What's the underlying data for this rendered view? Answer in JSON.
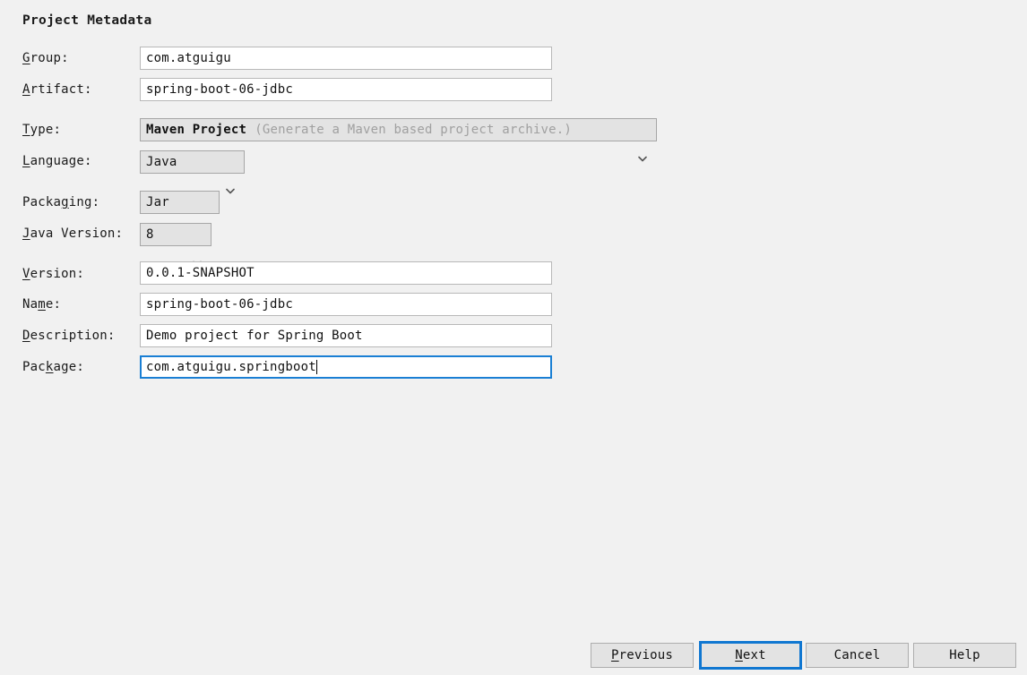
{
  "page_title": "Project Metadata",
  "form": {
    "group": {
      "label": "Group:",
      "mnemonic": "G",
      "value": "com.atguigu"
    },
    "artifact": {
      "label": "Artifact:",
      "mnemonic": "A",
      "value": "spring-boot-06-jdbc"
    },
    "type": {
      "label": "Type:",
      "mnemonic": "T",
      "value": "Maven Project",
      "hint": "(Generate a Maven based project archive.)",
      "icon": "chevron-down-icon"
    },
    "language": {
      "label": "Language:",
      "mnemonic": "L",
      "value": "Java",
      "icon": "chevron-down-icon"
    },
    "packaging": {
      "label": "Packaging:",
      "mnemonic": "g",
      "value": "Jar",
      "icon": "chevron-down-icon"
    },
    "java_version": {
      "label": "Java Version:",
      "mnemonic": "J",
      "value": "8",
      "icon": "chevron-down-icon"
    },
    "version": {
      "label": "Version:",
      "mnemonic": "V",
      "value": "0.0.1-SNAPSHOT"
    },
    "name": {
      "label": "Name:",
      "mnemonic": "m",
      "value": "spring-boot-06-jdbc"
    },
    "description": {
      "label": "Description:",
      "mnemonic": "D",
      "value": "Demo project for Spring Boot"
    },
    "package": {
      "label": "Package:",
      "mnemonic": "k",
      "value": "com.atguigu.springboot",
      "focused": true
    }
  },
  "buttons": {
    "previous": "Previous",
    "next": "Next",
    "cancel": "Cancel",
    "help": "Help"
  },
  "colors": {
    "background": "#f1f1f1",
    "focus_blue": "#1077d1",
    "field_white": "#ffffff",
    "control_gray": "#e3e3e3",
    "hint_gray": "#a0a0a0"
  }
}
